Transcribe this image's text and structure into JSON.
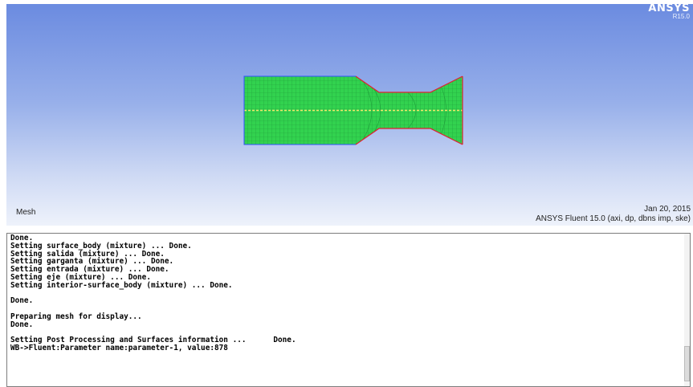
{
  "brand": {
    "name": "ANSYS",
    "version": "R15.0"
  },
  "viewport": {
    "label": "Mesh",
    "date": "Jan 20, 2015",
    "solver_info": "ANSYS Fluent 15.0 (axi, dp, dbns imp, ske)"
  },
  "colors": {
    "mesh_green": "#2bd94a",
    "boundary_red": "#e0202e",
    "axis_yellow": "#f4e66a",
    "inlet_blue": "#3050ff"
  },
  "console": {
    "lines": [
      "Done.",
      "Setting surface_body (mixture) ... Done.",
      "Setting salida (mixture) ... Done.",
      "Setting garganta (mixture) ... Done.",
      "Setting entrada (mixture) ... Done.",
      "Setting eje (mixture) ... Done.",
      "Setting interior-surface_body (mixture) ... Done.",
      "",
      "Done.",
      "",
      "Preparing mesh for display...",
      "Done.",
      "",
      "Setting Post Processing and Surfaces information ...      Done.",
      "WB->Fluent:Parameter name:parameter-1, value:878"
    ]
  }
}
